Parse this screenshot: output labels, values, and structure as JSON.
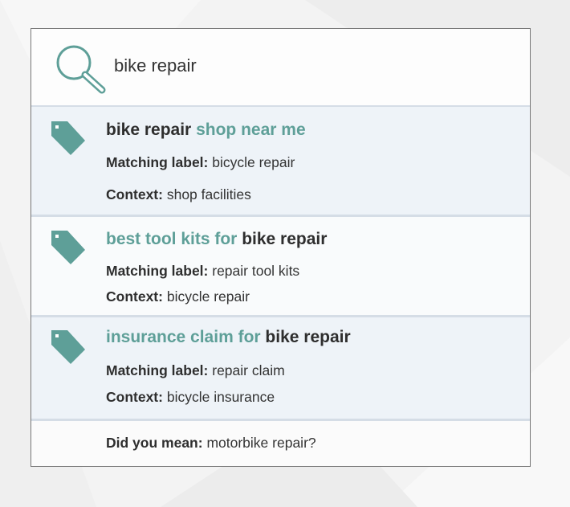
{
  "search": {
    "query": "bike repair"
  },
  "results": [
    {
      "title_plain": "bike repair",
      "title_accent": "shop near me",
      "matching_label_key": "Matching label:",
      "matching_label_value": "bicycle repair",
      "context_key": "Context:",
      "context_value": "shop facilities"
    },
    {
      "title_accent": "best tool kits for",
      "title_plain": "bike repair",
      "matching_label_key": "Matching label:",
      "matching_label_value": "repair tool kits",
      "context_key": "Context:",
      "context_value": "bicycle repair"
    },
    {
      "title_accent": "insurance claim for",
      "title_plain": "bike repair",
      "matching_label_key": "Matching label:",
      "matching_label_value": "repair claim",
      "context_key": "Context:",
      "context_value": "bicycle insurance"
    }
  ],
  "suggestion": {
    "key": "Did you mean:",
    "value": "motorbike repair?"
  },
  "icons": {
    "search": "search-icon",
    "result": "tag-icon"
  },
  "colors": {
    "accent": "#5e9f98",
    "text": "#2e2e2e",
    "row_bg": "#eef3f8",
    "divider": "#d5dde6"
  }
}
